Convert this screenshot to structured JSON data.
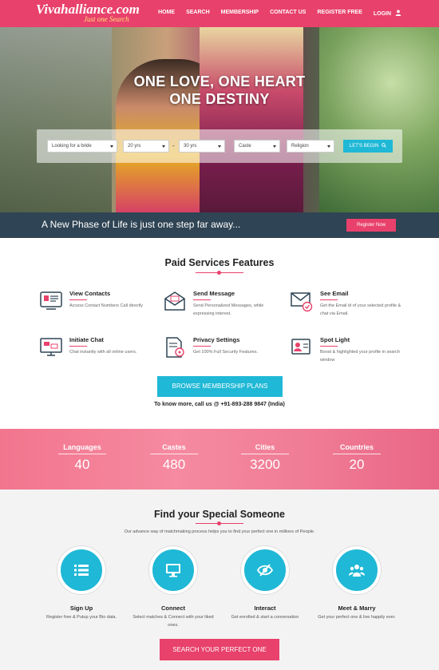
{
  "header": {
    "logo": "Vivahalliance.com",
    "tagline": "Just one Search",
    "nav": [
      "HOME",
      "SEARCH",
      "MEMBERSHIP",
      "CONTACT US",
      "REGISTER FREE",
      "LOGIN"
    ]
  },
  "hero": {
    "title_line1": "ONE LOVE, ONE HEART",
    "title_line2": "ONE DESTINY",
    "search": {
      "looking_for": "Looking for a bride",
      "age_from": "20 yrs",
      "age_sep": "-",
      "age_to": "30 yrs",
      "caste": "Caste",
      "religion": "Religion",
      "button": "LET'S BEGIN"
    }
  },
  "tagbar": {
    "text": "A New Phase of Life is just one step far away...",
    "button": "Register Now"
  },
  "services": {
    "title": "Paid Services Features",
    "items": [
      {
        "title": "View Contacts",
        "desc": "Access Contact Numbers Call directly",
        "icon": "contacts-icon"
      },
      {
        "title": "Send Message",
        "desc": "Send Personalized Messages, while expressing interest.",
        "icon": "envelope-icon"
      },
      {
        "title": "See Email",
        "desc": "Get the Email id of your selected profile & chat via Email.",
        "icon": "email-check-icon"
      },
      {
        "title": "Initiate Chat",
        "desc": "Chat instantly with all online users.",
        "icon": "chat-monitor-icon"
      },
      {
        "title": "Privacy Settings",
        "desc": "Get 100% Full Security Features.",
        "icon": "privacy-document-icon"
      },
      {
        "title": "Spot Light",
        "desc": "Boost & highlighted your profile in search window",
        "icon": "spotlight-profile-icon"
      }
    ],
    "browse_button": "BROWSE MEMBERSHIP PLANS",
    "contact_line": "To know more, call us @ +91-893-288 9847 (India)"
  },
  "stats": [
    {
      "label": "Languages",
      "value": "40"
    },
    {
      "label": "Castes",
      "value": "480"
    },
    {
      "label": "Cities",
      "value": "3200"
    },
    {
      "label": "Countries",
      "value": "20"
    }
  ],
  "find": {
    "title": "Find your Special Someone",
    "subtitle": "Our advance way of matchmaking process helps you to find your perfect one in millions of People.",
    "steps": [
      {
        "title": "Sign Up",
        "desc": "Register free & Putup your Bio data.",
        "icon": "list-icon"
      },
      {
        "title": "Connect",
        "desc": "Select matches & Connect with your liked ones.",
        "icon": "monitor-icon"
      },
      {
        "title": "Interact",
        "desc": "Get enrolled & start a conversation",
        "icon": "eye-icon"
      },
      {
        "title": "Meet & Marry",
        "desc": "Get your perfect one & live happily ever.",
        "icon": "group-icon"
      }
    ],
    "button": "SEARCH YOUR PERFECT ONE"
  },
  "colors": {
    "brand_pink": "#e8416b",
    "accent_cyan": "#1fb8d6",
    "dark_bar": "#2f4454"
  }
}
